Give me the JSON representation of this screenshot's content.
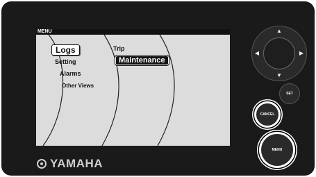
{
  "screen": {
    "header_label": "MENU",
    "column1": {
      "items": [
        {
          "label": "Logs",
          "selected": true
        },
        {
          "label": "Setting",
          "selected": false
        },
        {
          "label": "Alarms",
          "selected": false
        },
        {
          "label": "Other Views",
          "selected": false
        }
      ]
    },
    "column2": {
      "items": [
        {
          "label": "Trip",
          "selected": false
        },
        {
          "label": "Maintenance",
          "selected": true
        }
      ]
    }
  },
  "brand": {
    "name": "YAMAHA",
    "mark_icon": "yamaha-tuning-fork-icon"
  },
  "controls": {
    "dpad": {
      "up_icon": "arrow-up-icon",
      "down_icon": "arrow-down-icon",
      "left_icon": "arrow-left-icon",
      "right_icon": "arrow-right-icon"
    },
    "set_label": "SET",
    "cancel_label": "CANCEL",
    "menu_label": "MENU"
  },
  "colors": {
    "body": "#1a1a1a",
    "screen": "#dcdcdc",
    "highlight": "#ffffff"
  }
}
